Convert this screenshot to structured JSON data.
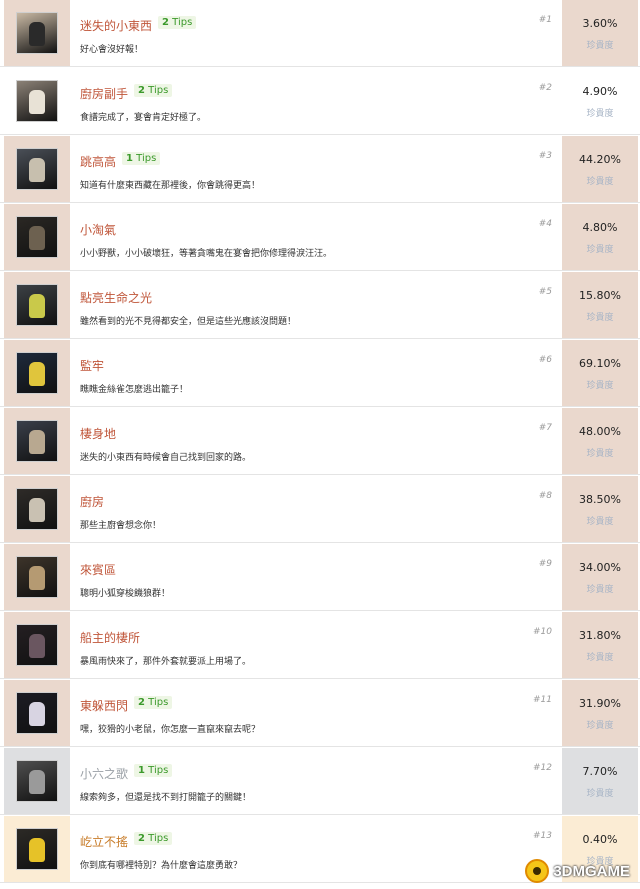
{
  "rarity_label": "珍貴度",
  "tips_suffix": "Tips",
  "achievements": [
    {
      "name": "迷失的小東西",
      "tips": "2",
      "desc": "好心會沒好報！",
      "num": "#1",
      "pct": "3.60%",
      "state": "unlocked",
      "thumb": {
        "bg": "#c9b9a4",
        "fig": "#2a2a2a",
        "icon": "child-figure-icon"
      }
    },
    {
      "name": "廚房副手",
      "tips": "2",
      "desc": "食譜完成了，宴會肯定好極了。",
      "num": "#2",
      "pct": "4.90%",
      "state": "normal",
      "thumb": {
        "bg": "#8b8176",
        "fig": "#e8e2d6",
        "icon": "bed-icon"
      }
    },
    {
      "name": "跳高高",
      "tips": "1",
      "desc": "知道有什麼東西藏在那裡後，你會跳得更高！",
      "num": "#3",
      "pct": "44.20%",
      "state": "unlocked",
      "thumb": {
        "bg": "#4a4f57",
        "fig": "#c7bfae",
        "icon": "room-icon"
      }
    },
    {
      "name": "小淘氣",
      "tips": "",
      "desc": "小小野獸，小小破壞狂，等著貪嘴鬼在宴會把你修理得淚汪汪。",
      "num": "#4",
      "pct": "4.80%",
      "state": "unlocked",
      "thumb": {
        "bg": "#2b2824",
        "fig": "#6d6150",
        "icon": "statue-icon"
      }
    },
    {
      "name": "點亮生命之光",
      "tips": "",
      "desc": "雖然看到的光不見得都安全，但是這些光應該沒問題！",
      "num": "#5",
      "pct": "15.80%",
      "state": "unlocked",
      "thumb": {
        "bg": "#3c4145",
        "fig": "#c9c94a",
        "icon": "lamp-icon"
      }
    },
    {
      "name": "監牢",
      "tips": "",
      "desc": "瞧瞧金絲雀怎麼逃出籠子！",
      "num": "#6",
      "pct": "69.10%",
      "state": "unlocked",
      "thumb": {
        "bg": "#1e2a3c",
        "fig": "#e0c53c",
        "icon": "cage-icon"
      }
    },
    {
      "name": "棲身地",
      "tips": "",
      "desc": "迷失的小東西有時候會自己找到回家的路。",
      "num": "#7",
      "pct": "48.00%",
      "state": "unlocked",
      "thumb": {
        "bg": "#3a3f4a",
        "fig": "#b8a890",
        "icon": "home-icon"
      }
    },
    {
      "name": "廚房",
      "tips": "",
      "desc": "那些主廚會想念你！",
      "num": "#8",
      "pct": "38.50%",
      "state": "unlocked",
      "thumb": {
        "bg": "#2e2b28",
        "fig": "#c9c1b2",
        "icon": "chef-icon"
      }
    },
    {
      "name": "來賓區",
      "tips": "",
      "desc": "聰明小狐穿梭饑狼群！",
      "num": "#9",
      "pct": "34.00%",
      "state": "unlocked",
      "thumb": {
        "bg": "#3d342a",
        "fig": "#b59a72",
        "icon": "guest-icon"
      }
    },
    {
      "name": "船主的棲所",
      "tips": "",
      "desc": "暴風雨快來了，那件外套就要派上用場了。",
      "num": "#10",
      "pct": "31.80%",
      "state": "unlocked",
      "thumb": {
        "bg": "#241f22",
        "fig": "#6a5660",
        "icon": "lady-icon"
      }
    },
    {
      "name": "東躲西閃",
      "tips": "2",
      "desc": "嘿，狡猾的小老鼠，你怎麼一直竄來竄去呢？",
      "num": "#11",
      "pct": "31.90%",
      "state": "unlocked",
      "thumb": {
        "bg": "#1c1c24",
        "fig": "#d8d4e2",
        "icon": "hand-icon"
      }
    },
    {
      "name": "小六之歌",
      "tips": "1",
      "desc": "線索夠多，但還是找不到打開籠子的關鍵！",
      "num": "#12",
      "pct": "7.70%",
      "state": "locked",
      "thumb": {
        "bg": "#4f4f4f",
        "fig": "#9a9a9a",
        "icon": "piano-icon"
      }
    },
    {
      "name": "屹立不搖",
      "tips": "2",
      "desc": "你到底有哪裡特別？為什麼會這麼勇敢？",
      "num": "#13",
      "pct": "0.40%",
      "state": "rare",
      "thumb": {
        "bg": "#2c2a26",
        "fig": "#e6c228",
        "icon": "raincoat-icon"
      }
    }
  ],
  "watermark": {
    "text": "3DMGAME",
    "icon": "3dm-logo-icon"
  },
  "colors": {
    "unlocked_fill": "#ead8cd",
    "locked_fill": "#dedfe1",
    "rare_fill": "#fbecd4",
    "title_normal": "#c0563a",
    "title_locked": "#9aa0a6",
    "title_rare": "#c77a26",
    "tips_text": "#3c9a2c",
    "rarity_text": "#a7b4c6"
  }
}
